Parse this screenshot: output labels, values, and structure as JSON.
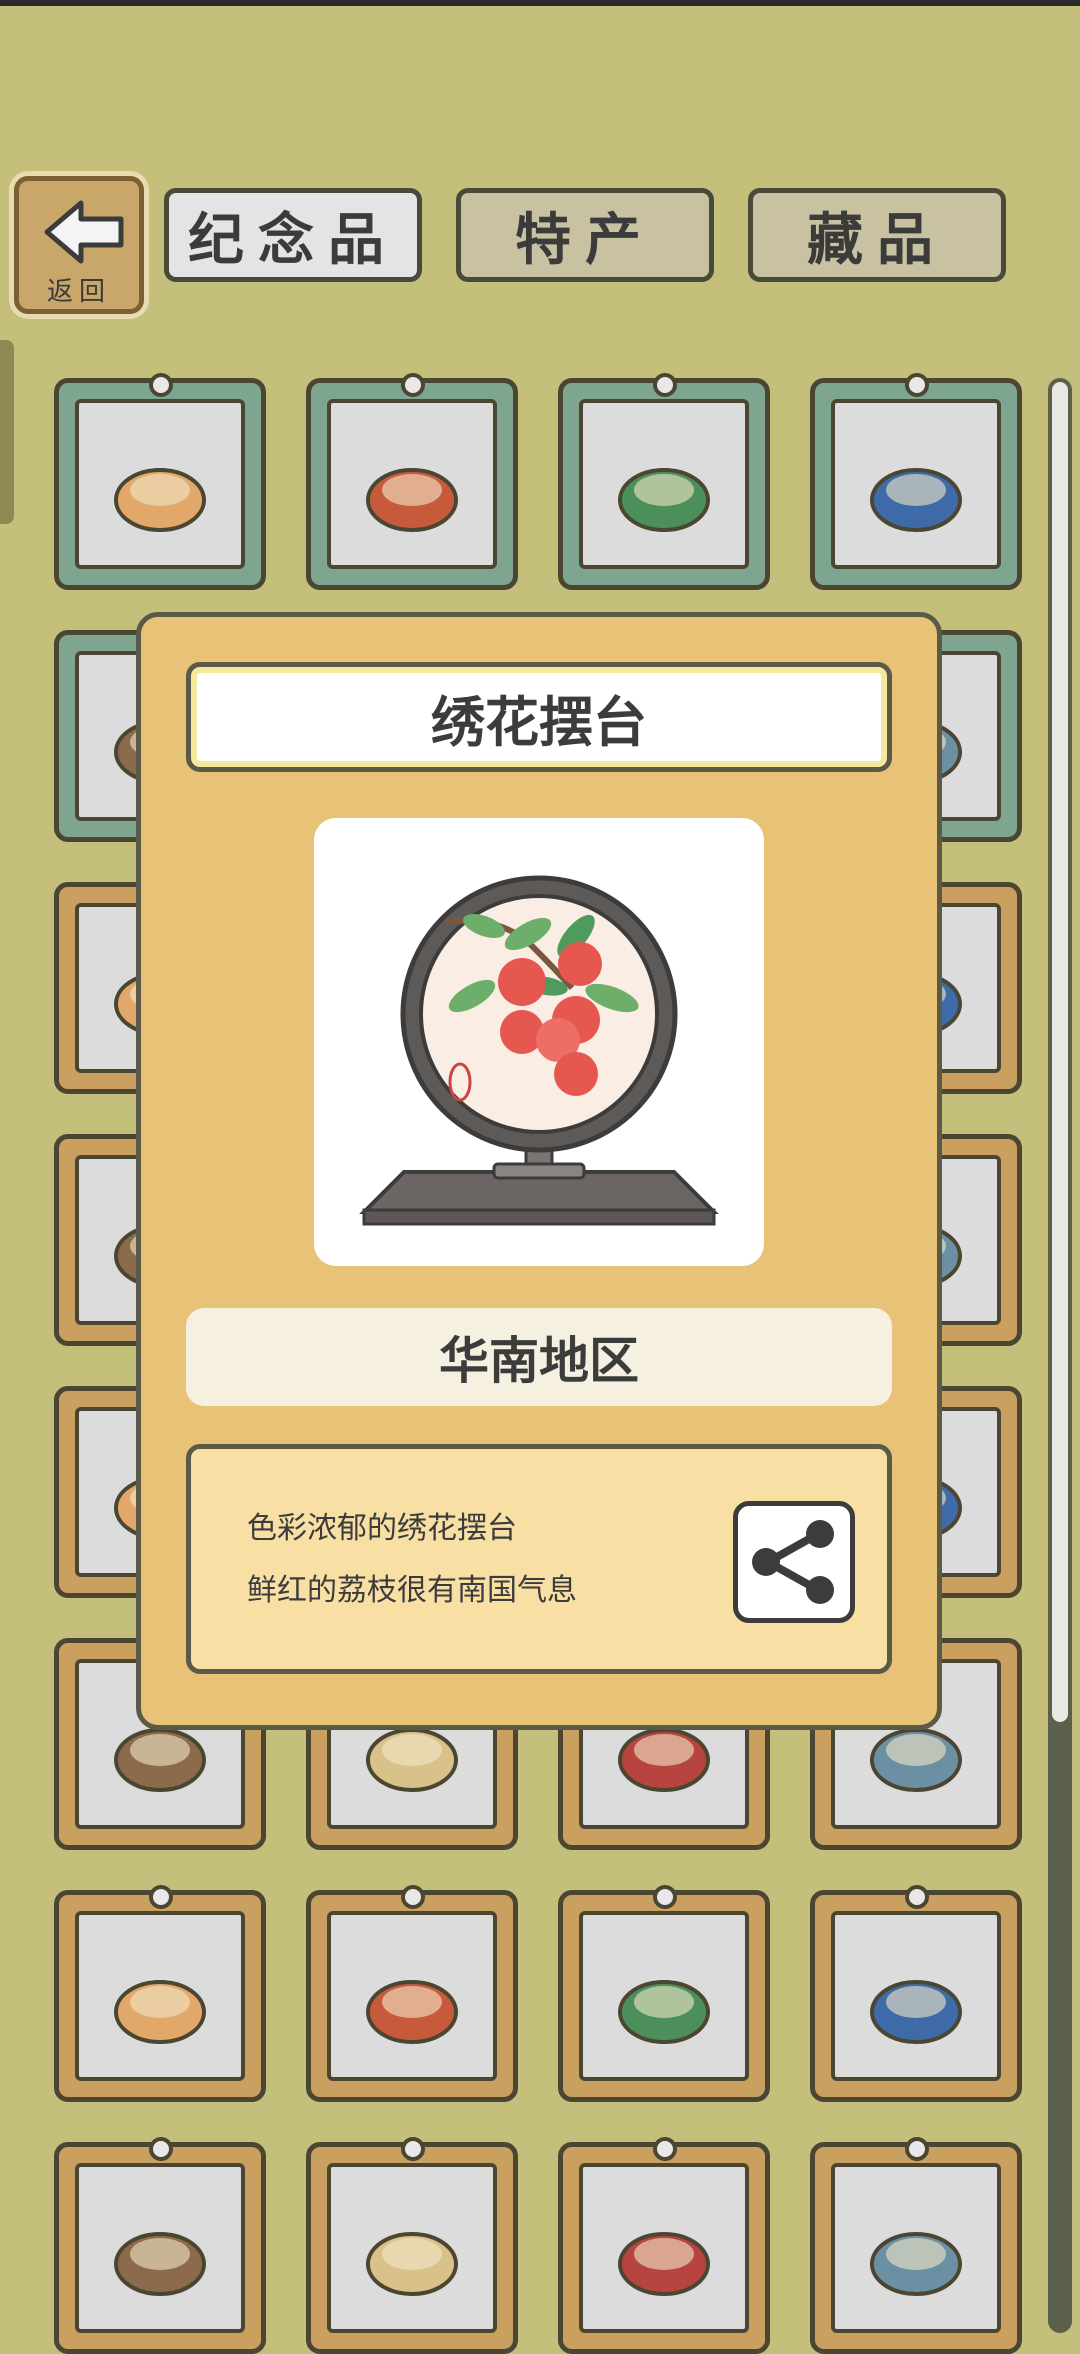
{
  "header": {
    "back_label": "返回",
    "tabs": [
      {
        "label": "纪念品",
        "active": true
      },
      {
        "label": "特产",
        "active": false
      },
      {
        "label": "藏品",
        "active": false
      }
    ]
  },
  "grid": {
    "rows": [
      {
        "frame": "teal",
        "items": [
          "red-bean-pastry",
          "moon-cake-plate",
          "square-moon-cakes",
          "egg-yolk-moon-cakes"
        ]
      },
      {
        "frame": "teal",
        "items": [
          "green-tea-cake",
          "hidden",
          "hidden",
          "embroidered-stand"
        ]
      },
      {
        "frame": "wood",
        "items": [
          "red-tassel",
          "hidden",
          "hidden",
          "colorful-rooster"
        ]
      },
      {
        "frame": "wood",
        "items": [
          "red-figurine",
          "hidden",
          "hidden",
          "porcelain-vase"
        ]
      },
      {
        "frame": "wood",
        "items": [
          "jade-bowl",
          "hidden",
          "hidden",
          "blue-white-vase"
        ]
      },
      {
        "frame": "wood",
        "items": [
          "prayer-beads",
          "chime-bells",
          "stone-turtle",
          "stone-statue"
        ]
      },
      {
        "frame": "wood",
        "items": [
          "tang-sancai-horse",
          "green-jade-cup",
          "chinese-knot-tassel",
          "pocket-watch"
        ]
      },
      {
        "frame": "wood",
        "items": [
          "double-decker-bus",
          "bamboo-ladle",
          "silver-lock-pendant",
          "blue-glaze-bowl"
        ]
      }
    ]
  },
  "popup": {
    "title": "绣花摆台",
    "region": "华南地区",
    "description": [
      "色彩浓郁的绣花摆台",
      "鲜红的荔枝很有南国气息"
    ],
    "share_icon": "share-icon"
  },
  "colors": {
    "background": "#c4bf7a",
    "popup": "#e8c277",
    "teal_frame": "#7ea590",
    "wood_frame": "#c9a060"
  }
}
